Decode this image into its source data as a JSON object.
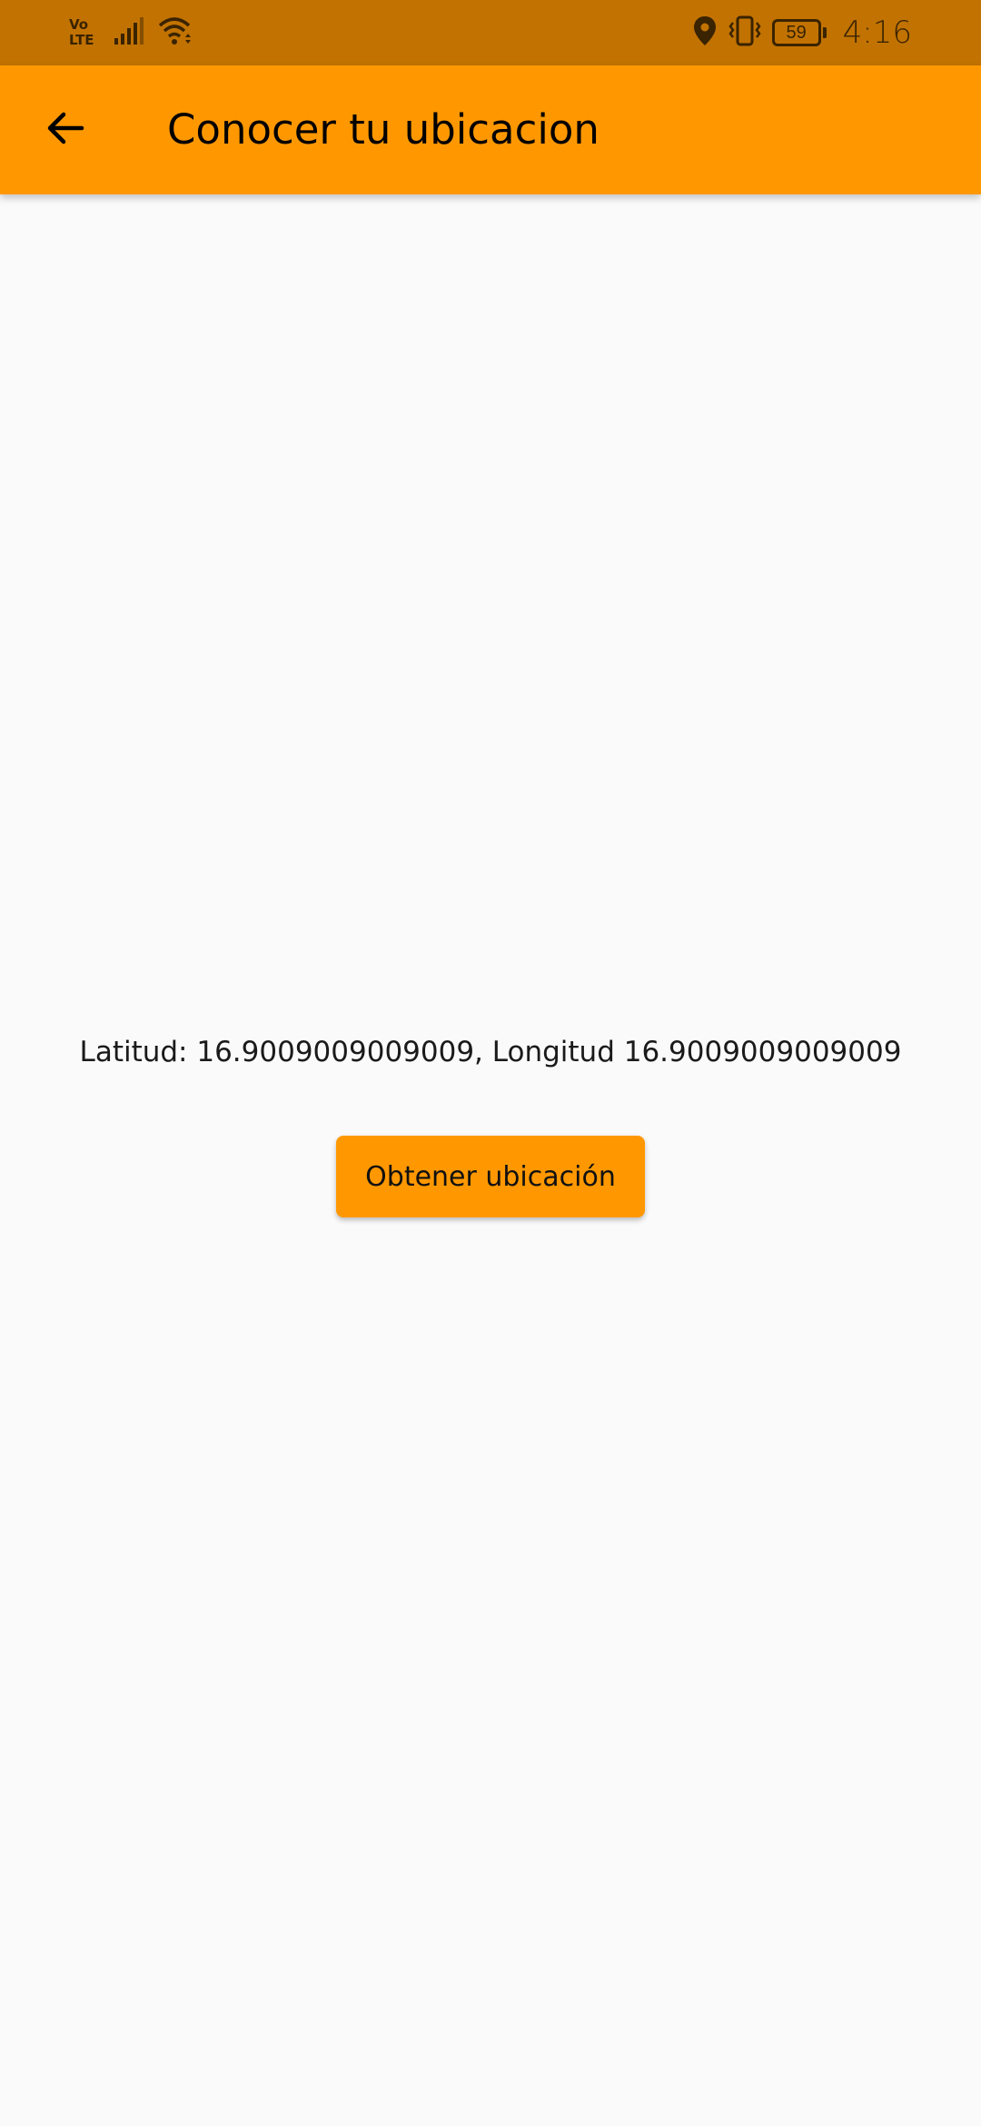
{
  "status_bar": {
    "network_line1": "Vo",
    "network_line2": "LTE",
    "battery_level": "59",
    "time": "4:16",
    "icons": [
      "volte-icon",
      "signal-icon",
      "wifi-icon",
      "location-icon",
      "vibrate-icon",
      "battery-icon"
    ]
  },
  "app_bar": {
    "back_icon": "arrow-back-icon",
    "title": "Conocer tu ubicacion"
  },
  "main": {
    "coordinates_text": "Latitud: 16.9009009009009, Longitud 16.9009009009009",
    "get_location_label": "Obtener ubicación"
  },
  "colors": {
    "status_bar": "#c17200",
    "app_bar": "#ff9800",
    "button": "#ff9800",
    "background": "#fafafa"
  }
}
